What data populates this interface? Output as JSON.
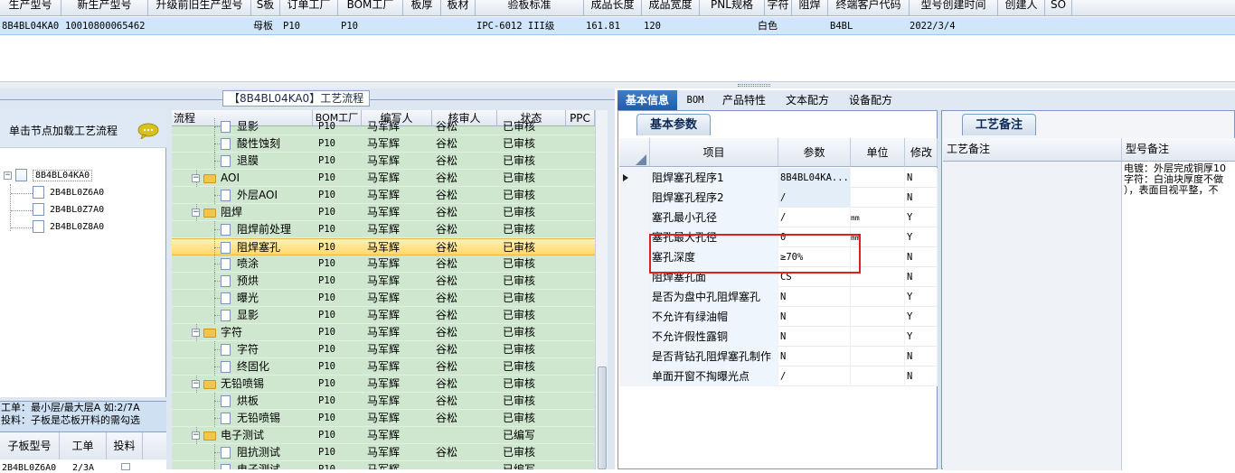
{
  "top_grid": {
    "headers": [
      "生产型号",
      "新生产型号",
      "升级前旧生产型号",
      "S板",
      "订单工厂",
      "BOM工厂",
      "板厚",
      "板材",
      "验板标准",
      "成品长度",
      "成品宽度",
      "PNL规格",
      "字符",
      "阻焊",
      "终端客户代码",
      "型号创建时间",
      "创建人",
      "SO"
    ],
    "row": {
      "production_model": "8B4BL04KA0",
      "new_production_model": "10010800065462",
      "old_model": "",
      "s_board": "母板",
      "order_factory": "P10",
      "bom_factory": "P10",
      "thickness": "",
      "material": "",
      "standard": "IPC-6012 III级",
      "length": "161.81",
      "width": "120",
      "pnl": "",
      "char": "白色",
      "solder": "",
      "customer_code": "B4BL",
      "created": "2022/3/4",
      "creator": "",
      "so": ""
    }
  },
  "flow_panel": {
    "title": "【8B4BL04KA0】工艺流程",
    "hint": "单击节点加载工艺流程",
    "tree": {
      "root": "8B4BL04KA0",
      "children": [
        "2B4BL0Z6A0",
        "2B4BL0Z7A0",
        "2B4BL0Z8A0"
      ]
    },
    "info_lines": [
      "工单：最小层/最大层A 如:2/7A",
      "投料：子板是芯板开料的需勾选"
    ],
    "sub_grid_headers": [
      "子板型号",
      "工单",
      "投料"
    ],
    "sub_grid_row": {
      "model": "2B4BL0Z6A0",
      "order": "2/3A",
      "feed": ""
    }
  },
  "flow_grid": {
    "headers": [
      "流程",
      "BOM工厂",
      "编写人",
      "核审人",
      "状态",
      "PPC"
    ],
    "rows": [
      {
        "level": 2,
        "name": "显影",
        "bom": "P10",
        "writer": "马军辉",
        "auditor": "谷松",
        "status": "已审核",
        "folder": false
      },
      {
        "level": 2,
        "name": "酸性蚀刻",
        "bom": "P10",
        "writer": "马军辉",
        "auditor": "谷松",
        "status": "已审核",
        "folder": false
      },
      {
        "level": 2,
        "name": "退膜",
        "bom": "P10",
        "writer": "马军辉",
        "auditor": "谷松",
        "status": "已审核",
        "folder": false
      },
      {
        "level": 1,
        "name": "AOI",
        "bom": "P10",
        "writer": "马军辉",
        "auditor": "谷松",
        "status": "已审核",
        "folder": true
      },
      {
        "level": 2,
        "name": "外层AOI",
        "bom": "P10",
        "writer": "马军辉",
        "auditor": "谷松",
        "status": "已审核",
        "folder": false
      },
      {
        "level": 1,
        "name": "阻焊",
        "bom": "P10",
        "writer": "马军辉",
        "auditor": "谷松",
        "status": "已审核",
        "folder": true
      },
      {
        "level": 2,
        "name": "阻焊前处理",
        "bom": "P10",
        "writer": "马军辉",
        "auditor": "谷松",
        "status": "已审核",
        "folder": false
      },
      {
        "level": 2,
        "name": "阻焊塞孔",
        "bom": "P10",
        "writer": "马军辉",
        "auditor": "谷松",
        "status": "已审核",
        "folder": false,
        "selected": true
      },
      {
        "level": 2,
        "name": "喷涂",
        "bom": "P10",
        "writer": "马军辉",
        "auditor": "谷松",
        "status": "已审核",
        "folder": false
      },
      {
        "level": 2,
        "name": "预烘",
        "bom": "P10",
        "writer": "马军辉",
        "auditor": "谷松",
        "status": "已审核",
        "folder": false
      },
      {
        "level": 2,
        "name": "曝光",
        "bom": "P10",
        "writer": "马军辉",
        "auditor": "谷松",
        "status": "已审核",
        "folder": false
      },
      {
        "level": 2,
        "name": "显影",
        "bom": "P10",
        "writer": "马军辉",
        "auditor": "谷松",
        "status": "已审核",
        "folder": false
      },
      {
        "level": 1,
        "name": "字符",
        "bom": "P10",
        "writer": "马军辉",
        "auditor": "谷松",
        "status": "已审核",
        "folder": true
      },
      {
        "level": 2,
        "name": "字符",
        "bom": "P10",
        "writer": "马军辉",
        "auditor": "谷松",
        "status": "已审核",
        "folder": false
      },
      {
        "level": 2,
        "name": "终固化",
        "bom": "P10",
        "writer": "马军辉",
        "auditor": "谷松",
        "status": "已审核",
        "folder": false
      },
      {
        "level": 1,
        "name": "无铅喷锡",
        "bom": "P10",
        "writer": "马军辉",
        "auditor": "谷松",
        "status": "已审核",
        "folder": true
      },
      {
        "level": 2,
        "name": "烘板",
        "bom": "P10",
        "writer": "马军辉",
        "auditor": "谷松",
        "status": "已审核",
        "folder": false
      },
      {
        "level": 2,
        "name": "无铅喷锡",
        "bom": "P10",
        "writer": "马军辉",
        "auditor": "谷松",
        "status": "已审核",
        "folder": false
      },
      {
        "level": 1,
        "name": "电子测试",
        "bom": "P10",
        "writer": "马军辉",
        "auditor": "",
        "status": "已编写",
        "folder": true
      },
      {
        "level": 2,
        "name": "阻抗测试",
        "bom": "P10",
        "writer": "马军辉",
        "auditor": "谷松",
        "status": "已审核",
        "folder": false
      },
      {
        "level": 2,
        "name": "电子测试",
        "bom": "P10",
        "writer": "马军辉",
        "auditor": "",
        "status": "已编写",
        "folder": false
      }
    ]
  },
  "right_tabs": [
    "基本信息",
    "BOM",
    "产品特性",
    "文本配方",
    "设备配方"
  ],
  "basic_panel": {
    "subtab": "基本参数",
    "headers": [
      "项目",
      "参数",
      "单位",
      "修改"
    ],
    "rows": [
      {
        "item": "阻焊塞孔程序1",
        "value": "8B4BL04KA...",
        "unit": "",
        "mod": "N",
        "current": true
      },
      {
        "item": "阻焊塞孔程序2",
        "value": "/",
        "unit": "",
        "mod": "N"
      },
      {
        "item": "塞孔最小孔径",
        "value": "/",
        "unit": "mm",
        "mod": "Y"
      },
      {
        "item": "塞孔最大孔径",
        "value": "0",
        "unit": "mm",
        "mod": "Y"
      },
      {
        "item": "塞孔深度",
        "value": "≥70%",
        "unit": "",
        "mod": "N"
      },
      {
        "item": "阻焊塞孔面",
        "value": "CS",
        "unit": "",
        "mod": "N"
      },
      {
        "item": "是否为盘中孔阻焊塞孔",
        "value": "N",
        "unit": "",
        "mod": "Y"
      },
      {
        "item": "不允许有绿油帽",
        "value": "N",
        "unit": "",
        "mod": "Y"
      },
      {
        "item": "不允许假性露铜",
        "value": "N",
        "unit": "",
        "mod": "Y"
      },
      {
        "item": "是否背钻孔阻焊塞孔制作",
        "value": "N",
        "unit": "",
        "mod": "N"
      },
      {
        "item": "单面开窗不掏曝光点",
        "value": "/",
        "unit": "",
        "mod": "N"
      }
    ]
  },
  "note_panel": {
    "subtab": "工艺备注",
    "headers": [
      "工艺备注",
      "型号备注"
    ],
    "model_note_lines": [
      "电镀：外层完成铜厚10",
      "字符：白油块厚度不做",
      "），表面目视平整，不"
    ]
  },
  "colors": {
    "selected_row": "#ffd86a",
    "flow_bg": "#cfe7cf",
    "tab_active": "#1f5ea8",
    "highlight_box": "#e02020"
  }
}
